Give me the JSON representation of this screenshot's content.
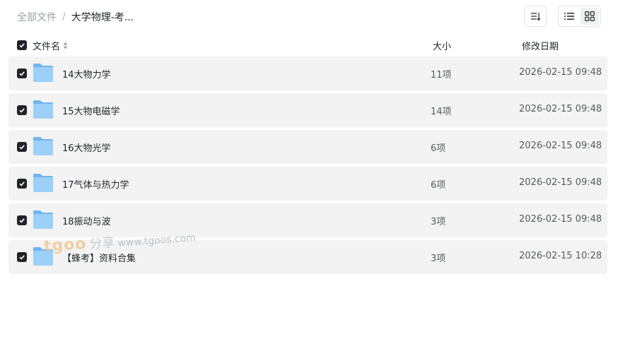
{
  "breadcrumb": {
    "root": "全部文件",
    "separator": "/",
    "current": "大学物理-考..."
  },
  "toolbar": {
    "sort_icon": "sort-list-icon",
    "list_view_icon": "list-view-icon",
    "grid_view_icon": "grid-view-icon"
  },
  "columns": {
    "name": "文件名",
    "size": "大小",
    "date": "修改日期"
  },
  "files": [
    {
      "name": "14大物力学",
      "size": "11项",
      "date": "2026-02-15 09:48"
    },
    {
      "name": "15大物电磁学",
      "size": "14项",
      "date": "2026-02-15 09:48"
    },
    {
      "name": "16大物光学",
      "size": "6项",
      "date": "2026-02-15 09:48"
    },
    {
      "name": "17气体与热力学",
      "size": "6项",
      "date": "2026-02-15 09:48"
    },
    {
      "name": "18振动与波",
      "size": "3项",
      "date": "2026-02-15 09:48"
    },
    {
      "name": "【蜂考】资料合集",
      "size": "3项",
      "date": "2026-02-15 10:28"
    }
  ],
  "watermark": {
    "brand": "tgoo",
    "share": "分享",
    "url": "www.tgoos.com"
  },
  "colors": {
    "row_bg": "#f3f3f3",
    "checkbox": "#1f2329",
    "folder": "#8cc6f5"
  }
}
